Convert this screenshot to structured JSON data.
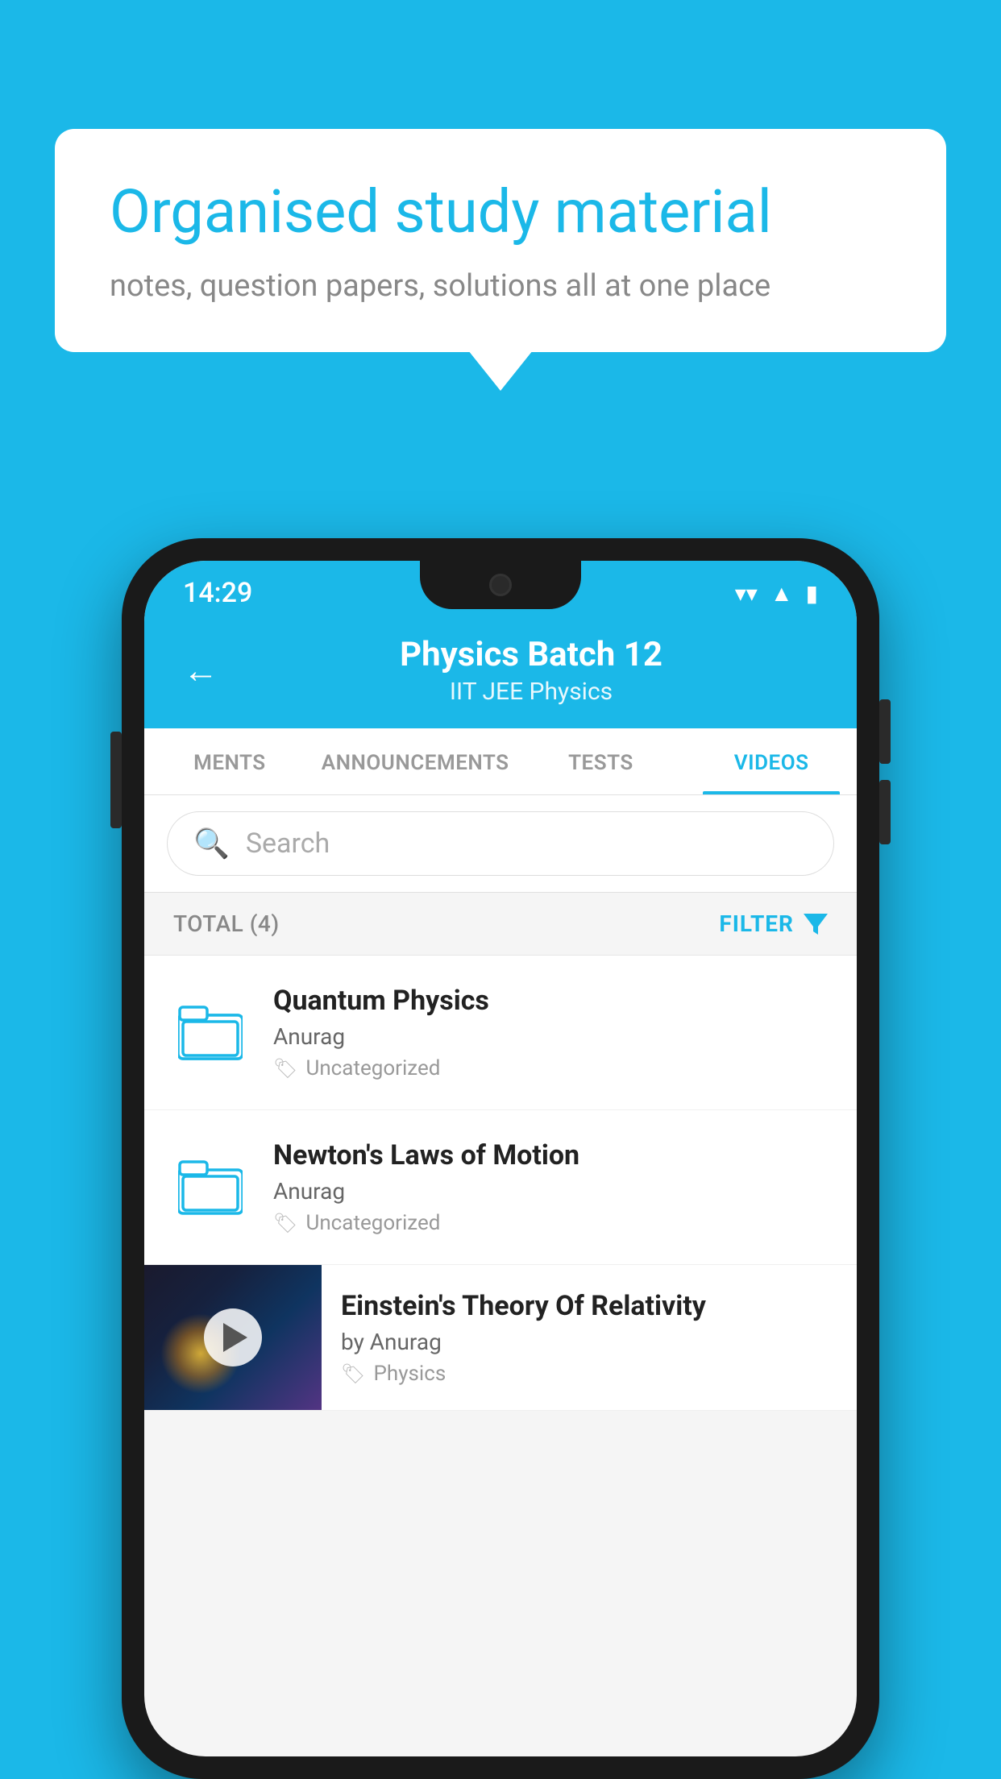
{
  "background_color": "#1BB8E8",
  "bubble": {
    "title": "Organised study material",
    "subtitle": "notes, question papers, solutions all at one place"
  },
  "status_bar": {
    "time": "14:29",
    "icons": [
      "wifi",
      "signal",
      "battery"
    ]
  },
  "header": {
    "back_label": "←",
    "title": "Physics Batch 12",
    "subtitle": "IIT JEE    Physics"
  },
  "tabs": [
    {
      "label": "MENTS",
      "active": false
    },
    {
      "label": "ANNOUNCEMENTS",
      "active": false
    },
    {
      "label": "TESTS",
      "active": false
    },
    {
      "label": "VIDEOS",
      "active": true
    }
  ],
  "search": {
    "placeholder": "Search"
  },
  "filter_bar": {
    "total_label": "TOTAL (4)",
    "filter_label": "FILTER"
  },
  "videos": [
    {
      "id": 1,
      "title": "Quantum Physics",
      "author": "Anurag",
      "tag": "Uncategorized",
      "has_thumbnail": false
    },
    {
      "id": 2,
      "title": "Newton's Laws of Motion",
      "author": "Anurag",
      "tag": "Uncategorized",
      "has_thumbnail": false
    },
    {
      "id": 3,
      "title": "Einstein's Theory Of Relativity",
      "author": "by Anurag",
      "tag": "Physics",
      "has_thumbnail": true
    }
  ]
}
